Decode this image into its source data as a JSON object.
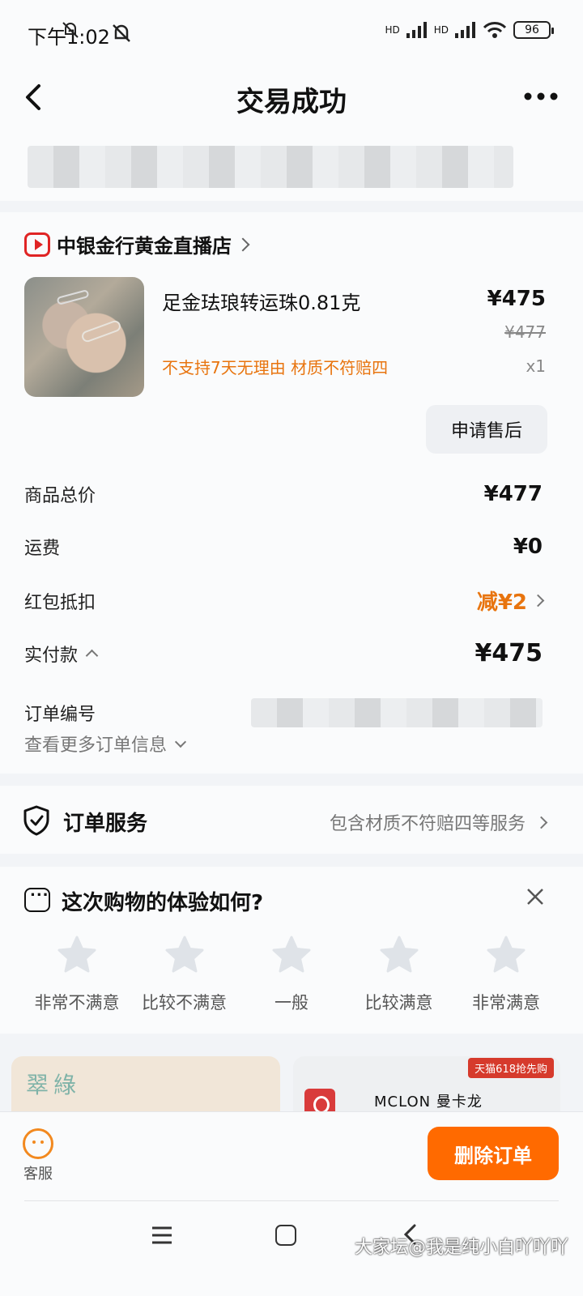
{
  "status_bar": {
    "time": "下午1:02",
    "battery": "96",
    "network_1": "HD",
    "network_2": "HD"
  },
  "nav": {
    "title": "交易成功"
  },
  "shop": {
    "name": "中银金行黄金直播店"
  },
  "product": {
    "title": "足金珐琅转运珠0.81克",
    "tags": "不支持7天无理由  材质不符赔四",
    "price_now": "¥475",
    "price_old": "¥477",
    "qty": "x1"
  },
  "actions": {
    "aftersale": "申请售后",
    "delete_order": "删除订单",
    "customer_service": "客服"
  },
  "summary": {
    "goods_total_label": "商品总价",
    "goods_total_value": "¥477",
    "shipping_label": "运费",
    "shipping_value": "¥0",
    "coupon_label": "红包抵扣",
    "coupon_value": "减¥2",
    "paid_label": "实付款",
    "paid_value": "¥475",
    "order_no_label": "订单编号",
    "more_info": "查看更多订单信息"
  },
  "service": {
    "title": "订单服务",
    "desc": "包含材质不符赔四等服务"
  },
  "feedback": {
    "title": "这次购物的体验如何?",
    "ratings": [
      "非常不满意",
      "比较不满意",
      "一般",
      "比较满意",
      "非常满意"
    ]
  },
  "recommend": {
    "left_title": "翠綠",
    "right_badge": "天猫618抢先购",
    "right_brand": "MCLON 曼卡龙"
  },
  "watermark": "大家坛@我是纯小白吖吖吖",
  "colors": {
    "accent_orange": "#ff6a00",
    "tag_orange": "#e8740e",
    "shop_red": "#e02424"
  }
}
